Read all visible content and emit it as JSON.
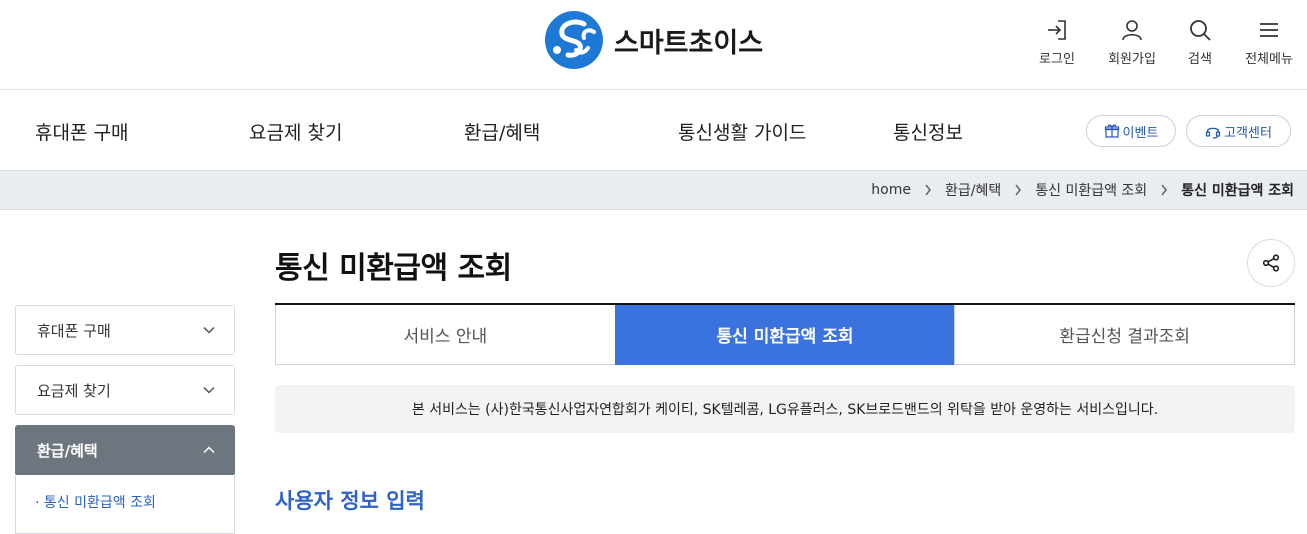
{
  "header": {
    "logo_text": "스마트초이스",
    "utils": [
      {
        "label": "로그인",
        "icon": "login-icon"
      },
      {
        "label": "회원가입",
        "icon": "user-icon"
      },
      {
        "label": "검색",
        "icon": "search-icon"
      },
      {
        "label": "전체메뉴",
        "icon": "hamburger-icon"
      }
    ]
  },
  "gnb": {
    "items": [
      "휴대폰 구매",
      "요금제 찾기",
      "환급/혜택",
      "통신생활 가이드",
      "통신정보"
    ],
    "event_label": "이벤트",
    "support_label": "고객센터"
  },
  "breadcrumb": [
    "home",
    "환급/혜택",
    "통신 미환급액 조회",
    "통신 미환급액 조회"
  ],
  "sidebar": {
    "items": [
      {
        "label": "휴대폰 구매",
        "expanded": false
      },
      {
        "label": "요금제 찾기",
        "expanded": false
      },
      {
        "label": "환급/혜택",
        "expanded": true
      }
    ],
    "sub_items": [
      "통신 미환급액 조회"
    ]
  },
  "main": {
    "title": "통신 미환급액 조회",
    "tabs": [
      {
        "label": "서비스 안내",
        "active": false
      },
      {
        "label": "통신 미환급액 조회",
        "active": true
      },
      {
        "label": "환급신청 결과조회",
        "active": false
      }
    ],
    "notice": "본 서비스는 (사)한국통신사업자연합회가 케이티, SK텔레콤, LG유플러스, SK브로드밴드의 위탁을 받아 운영하는 서비스입니다.",
    "section_title": "사용자 정보 입력"
  },
  "colors": {
    "accent": "#3a73dd",
    "sidebar_active": "#6d757e",
    "section_title": "#2d62c8",
    "logo_blue": "#1e78d6"
  }
}
